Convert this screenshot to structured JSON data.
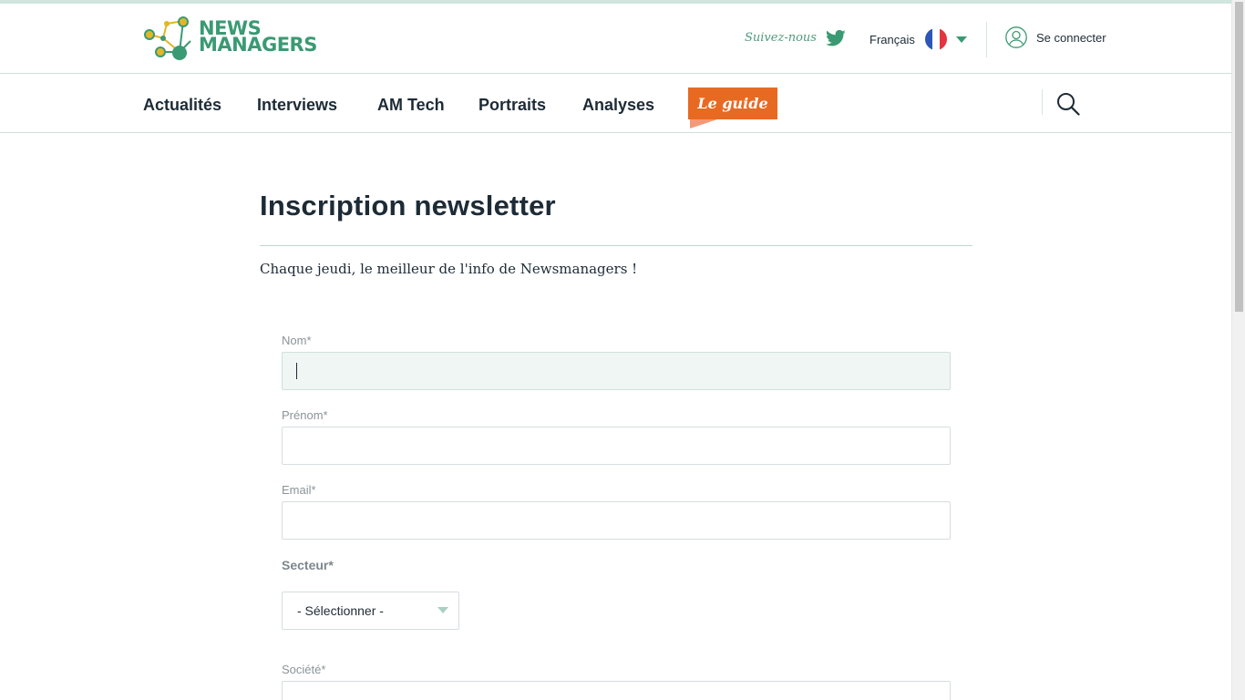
{
  "brand": {
    "logo_line1": "NEWS",
    "logo_line2": "MANAGERS",
    "logo_color": "#3a9a73",
    "accent_color": "#e86a22"
  },
  "header": {
    "follow_label": "Suivez-nous",
    "social_icon": "twitter-icon",
    "language_label": "Français",
    "language_flag": "flag-fr-icon",
    "login_label": "Se connecter",
    "login_icon": "user-icon"
  },
  "nav": {
    "items": [
      {
        "label": "Actualités"
      },
      {
        "label": "Interviews"
      },
      {
        "label": "AM Tech"
      },
      {
        "label": "Portraits"
      },
      {
        "label": "Analyses"
      }
    ],
    "guide_label": "Le guide",
    "search_icon": "search-icon"
  },
  "main": {
    "title": "Inscription newsletter",
    "subtitle": "Chaque jeudi, le meilleur de l'info de Newsmanagers !",
    "form": {
      "nom_label": "Nom*",
      "nom_value": "",
      "prenom_label": "Prénom*",
      "prenom_value": "",
      "email_label": "Email*",
      "email_value": "",
      "secteur_label": "Secteur*",
      "secteur_selected": "- Sélectionner -",
      "societe_label": "Société*",
      "societe_value": ""
    }
  }
}
